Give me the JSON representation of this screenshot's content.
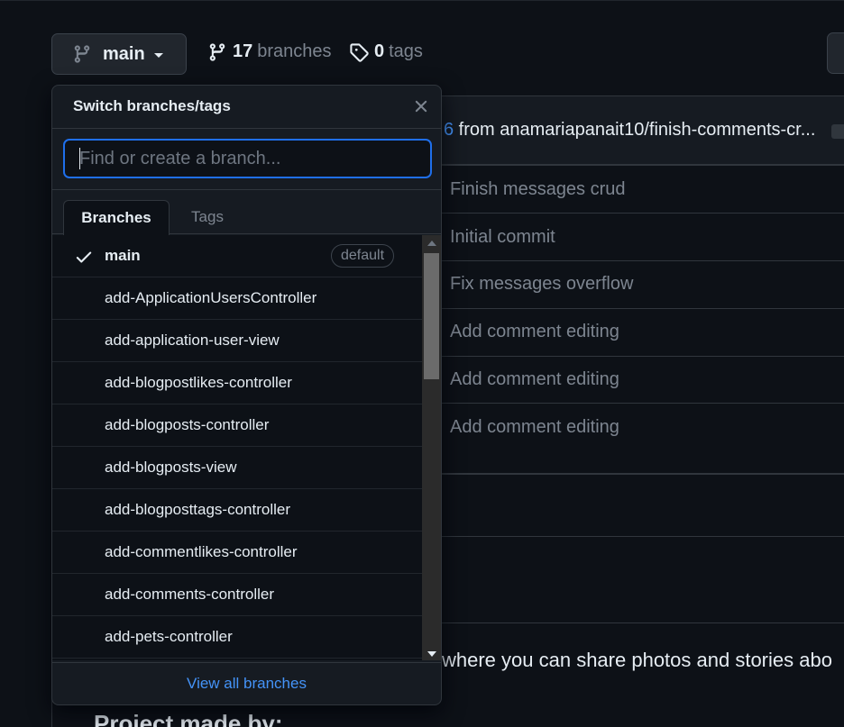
{
  "toolbar": {
    "branch_button_label": "main",
    "branch_count": "17",
    "branch_word": "branches",
    "tag_count": "0",
    "tag_word": "tags"
  },
  "commit": {
    "header_pr_fragment": "6",
    "header_text": " from anamariapanait10/finish-comments-cr...",
    "file_messages": [
      "Finish messages crud",
      "Initial commit",
      "Fix messages overflow",
      "Add comment editing",
      "Add comment editing",
      "Add comment editing"
    ]
  },
  "readme": {
    "text": "where you can share photos and stories abo",
    "heading": "Project made by:"
  },
  "dropdown": {
    "title": "Switch branches/tags",
    "search_placeholder": "Find or create a branch...",
    "tabs": [
      "Branches",
      "Tags"
    ],
    "default_badge": "default",
    "branches": [
      "main",
      "add-ApplicationUsersController",
      "add-application-user-view",
      "add-blogpostlikes-controller",
      "add-blogposts-controller",
      "add-blogposts-view",
      "add-blogposttags-controller",
      "add-commentlikes-controller",
      "add-comments-controller",
      "add-pets-controller"
    ],
    "footer_link": "View all branches"
  },
  "colors": {
    "background": "#0d1117",
    "panel": "#161b22",
    "border": "#30363d",
    "accent_blue": "#4493f8",
    "focus_blue": "#1f6feb",
    "muted": "#7d8590"
  }
}
